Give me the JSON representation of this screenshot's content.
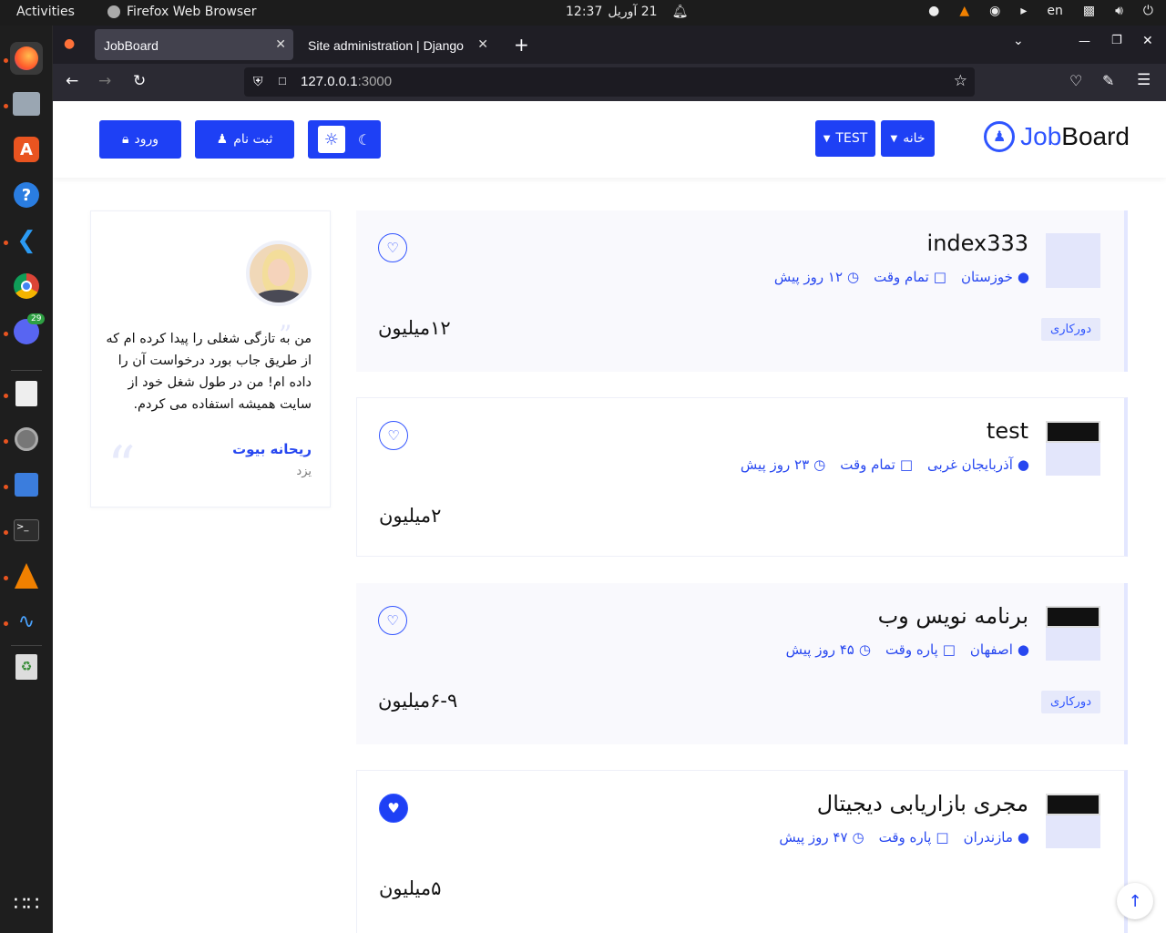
{
  "os": {
    "activities": "Activities",
    "app_name": "Firefox Web Browser",
    "clock_time": "12:37",
    "clock_date": "21 آوریل",
    "lang": "en",
    "discord_badge": "29"
  },
  "browser": {
    "tabs": [
      {
        "label": "JobBoard"
      },
      {
        "label": "Site administration | Django"
      }
    ],
    "url_host": "127.0.0.1",
    "url_port": ":3000"
  },
  "site": {
    "logo_job": "Job",
    "logo_board": "Board",
    "nav_home": "خانه",
    "nav_test": "TEST",
    "login": "ورود",
    "register": "ثبت نام"
  },
  "jobs": [
    {
      "title": "index333",
      "location": "خوزستان",
      "type": "تمام وقت",
      "posted": "۱۲ روز پیش",
      "salary": "۱۲میلیون",
      "badge": "دورکاری",
      "favorited": false
    },
    {
      "title": "test",
      "location": "آذربایجان غربی",
      "type": "تمام وقت",
      "posted": "۲۳ روز پیش",
      "salary": "۲میلیون",
      "badge": "",
      "favorited": false
    },
    {
      "title": "برنامه نویس وب",
      "location": "اصفهان",
      "type": "پاره وقت",
      "posted": "۴۵ روز پیش",
      "salary": "۶-۹میلیون",
      "badge": "دورکاری",
      "favorited": false
    },
    {
      "title": "مجری بازاریابی دیجیتال",
      "location": "مازندران",
      "type": "پاره وقت",
      "posted": "۴۷ روز پیش",
      "salary": "۵میلیون",
      "badge": "",
      "favorited": true
    }
  ],
  "testimonial": {
    "text": "من به تازگی شغلی را پیدا کرده ام که از طریق جاب بورد درخواست آن را داده ام! من در طول شغل خود از سایت همیشه استفاده می کردم.",
    "author": "ریحانه بیوت",
    "city": "یزد"
  },
  "colors": {
    "accent": "#1e40f5"
  }
}
